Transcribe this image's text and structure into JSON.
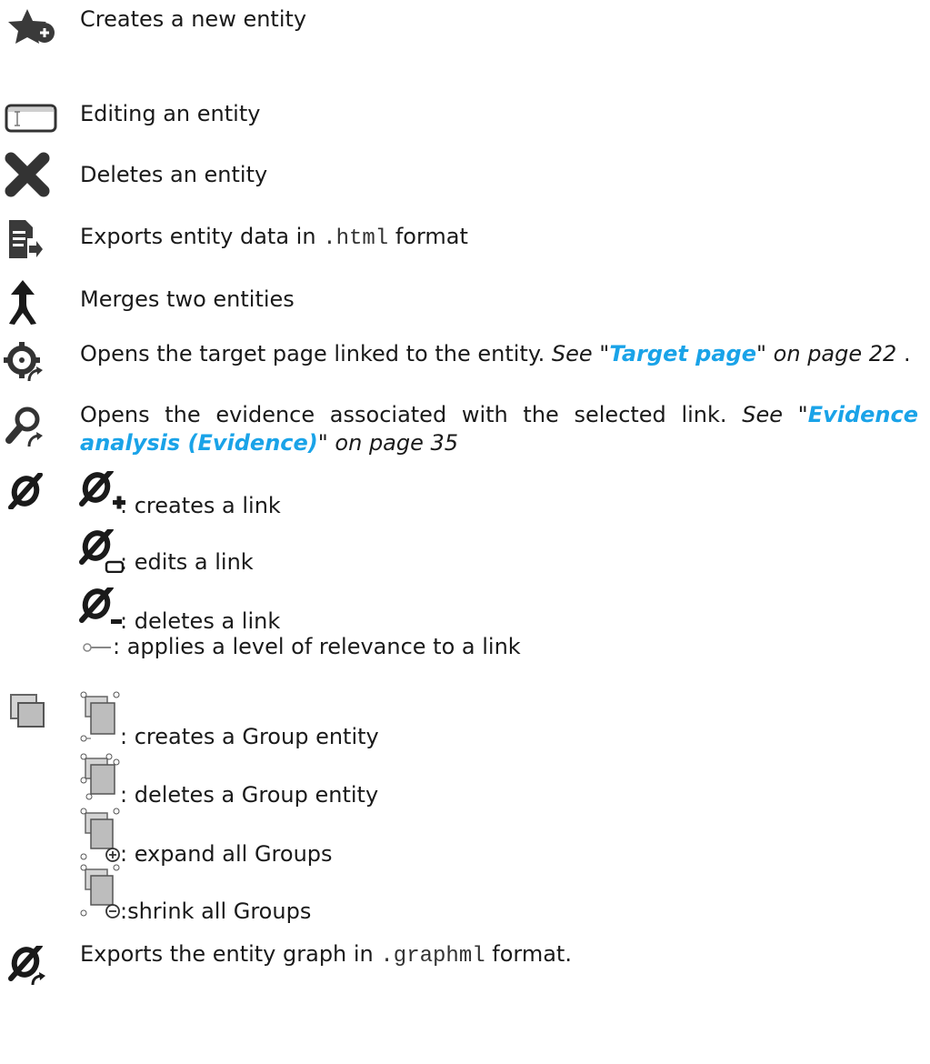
{
  "rows": {
    "create_entity": "Creates a new entity",
    "edit_entity": "Editing an entity",
    "delete_entity": "Deletes an entity",
    "export_html": {
      "before": "Exports entity data in ",
      "code": ".html",
      "after": " format"
    },
    "merge_entities": "Merges two entities",
    "open_target": {
      "text": "Opens the target page linked to the entity. ",
      "see": "See \"",
      "link": "Target page",
      "after": "\" on page 22",
      "end": " ."
    },
    "open_evidence": {
      "text": "Opens the evidence associated with the selected link. ",
      "see": "See \"",
      "link": "Evidence analysis (Evidence)",
      "after": "\" on page 35"
    },
    "links": {
      "create": ": creates a link",
      "edit": ": edits a link",
      "delete": ": deletes a link",
      "relevance": " : applies a level of relevance to a link"
    },
    "groups": {
      "create": ": creates a Group entity",
      "delete": ": deletes a Group entity",
      "expand": ": expand all Groups",
      "shrink": ":shrink all Groups"
    },
    "export_graph": {
      "before": "Exports the entity graph in ",
      "code": ".graphml",
      "after": " format."
    }
  },
  "icons": {
    "star": "star-plus-icon",
    "edit": "text-field-icon",
    "delete": "x-icon",
    "export": "document-export-icon",
    "merge": "merge-arrow-icon",
    "target": "target-icon",
    "evidence": "magnifier-icon",
    "link": "link-icon",
    "group": "group-icon",
    "graph_export": "link-export-icon"
  },
  "colors": {
    "link_text": "#1aa3e8",
    "icon_dark": "#333333"
  }
}
